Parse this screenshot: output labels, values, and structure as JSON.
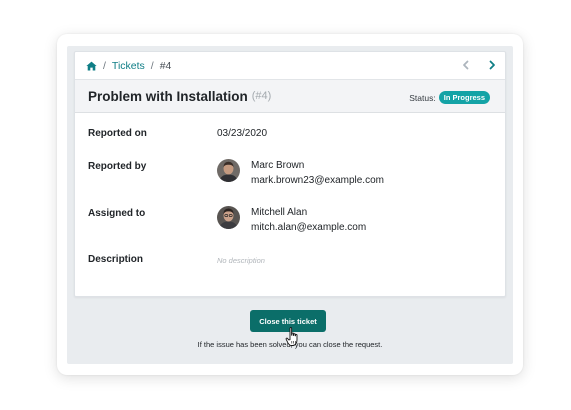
{
  "breadcrumb": {
    "home_icon": "home-icon",
    "separator": "/",
    "tickets_label": "Tickets",
    "current": "#4"
  },
  "pager": {
    "prev_icon": "chevron-left-icon",
    "next_icon": "chevron-right-icon"
  },
  "ticket": {
    "title": "Problem with Installation",
    "number": "(#4)",
    "status_label": "Status:",
    "status_value": "In Progress"
  },
  "fields": {
    "reported_on": {
      "label": "Reported on",
      "value": "03/23/2020"
    },
    "reported_by": {
      "label": "Reported by",
      "name": "Marc Brown",
      "email": "mark.brown23@example.com"
    },
    "assigned_to": {
      "label": "Assigned to",
      "name": "Mitchell Alan",
      "email": "mitch.alan@example.com"
    },
    "description": {
      "label": "Description",
      "value": "No description"
    }
  },
  "actions": {
    "close_label": "Close this ticket",
    "hint": "If the issue has been solved, you can close the request."
  },
  "colors": {
    "accent": "#0f7e86",
    "status_badge": "#14a3a6",
    "close_button": "#0b6e69"
  }
}
